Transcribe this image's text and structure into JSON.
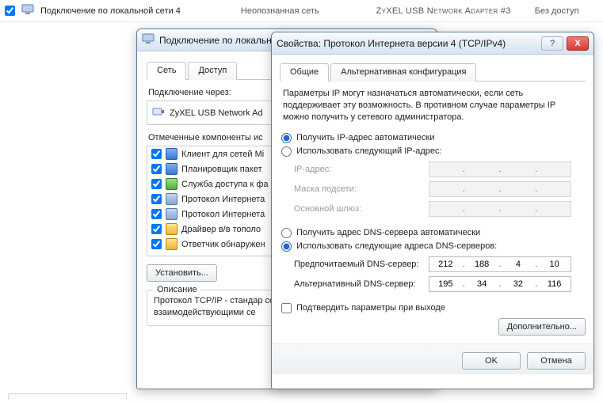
{
  "top": {
    "checked": true,
    "conn_name": "Подключение по локальной сети 4",
    "status": "Неопознанная сеть",
    "device": "ZyXEL USB Network Adapter #3",
    "access": "Без доступ"
  },
  "winA": {
    "title": "Подключение по локальн",
    "tabs": {
      "net": "Сеть",
      "access": "Доступ"
    },
    "connect_via_label": "Подключение через:",
    "adapter": "ZyXEL USB Network Ad",
    "components_label": "Отмеченные компоненты ис",
    "items": [
      "Клиент для сетей Mi",
      "Планировщик пакет",
      "Служба доступа к фа",
      "Протокол Интернета",
      "Протокол Интернета",
      "Драйвер в/в тополо",
      "Ответчик обнаружен"
    ],
    "install_btn": "Установить...",
    "desc_title": "Описание",
    "desc_text": "Протокол TCP/IP - стандар сетей, обеспечивающий с взаимодействующими се"
  },
  "winB": {
    "title": "Свойства: Протокол Интернета версии 4 (TCP/IPv4)",
    "tabs": {
      "general": "Общие",
      "alt": "Альтернативная конфигурация"
    },
    "info": "Параметры IP могут назначаться автоматически, если сеть поддерживает эту возможность. В противном случае параметры IP можно получить у сетевого администратора.",
    "ip_auto": "Получить IP-адрес автоматически",
    "ip_manual": "Использовать следующий IP-адрес:",
    "fields": {
      "ip": "IP-адрес:",
      "mask": "Маска подсети:",
      "gw": "Основной шлюз:"
    },
    "dns_auto": "Получить адрес DNS-сервера автоматически",
    "dns_manual": "Использовать следующие адреса DNS-серверов:",
    "dns_pref_label": "Предпочитаемый DNS-сервер:",
    "dns_alt_label": "Альтернативный DNS-сервер:",
    "dns_pref": [
      "212",
      "188",
      "4",
      "10"
    ],
    "dns_alt": [
      "195",
      "34",
      "32",
      "116"
    ],
    "confirm_exit": "Подтвердить параметры при выходе",
    "advanced_btn": "Дополнительно...",
    "ok": "OK",
    "cancel": "Отмена",
    "help": "?",
    "close": "X"
  }
}
